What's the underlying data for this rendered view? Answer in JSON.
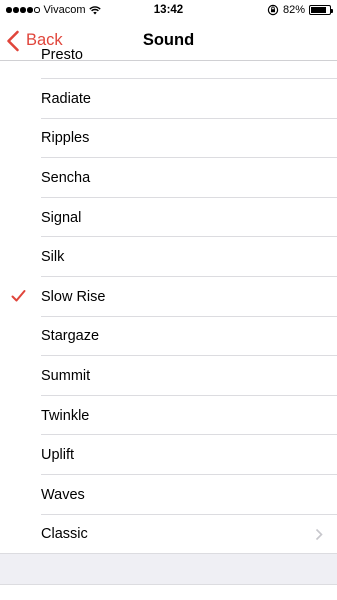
{
  "status_bar": {
    "carrier": "Vivacom",
    "time": "13:42",
    "battery": "82%",
    "battery_level": 0.82,
    "signal_filled": 4,
    "signal_total": 5
  },
  "nav": {
    "back_label": "Back",
    "title": "Sound"
  },
  "sounds": {
    "partial_top": "Presto",
    "items": [
      {
        "label": "Radiate"
      },
      {
        "label": "Ripples"
      },
      {
        "label": "Sencha"
      },
      {
        "label": "Signal"
      },
      {
        "label": "Silk"
      },
      {
        "label": "Slow Rise",
        "selected": true
      },
      {
        "label": "Stargaze"
      },
      {
        "label": "Summit"
      },
      {
        "label": "Twinkle"
      },
      {
        "label": "Uplift"
      },
      {
        "label": "Waves"
      }
    ],
    "classic_label": "Classic"
  },
  "colors": {
    "accent": "#e0453b",
    "separator": "#dcdce0",
    "group_bg": "#efeff4"
  }
}
